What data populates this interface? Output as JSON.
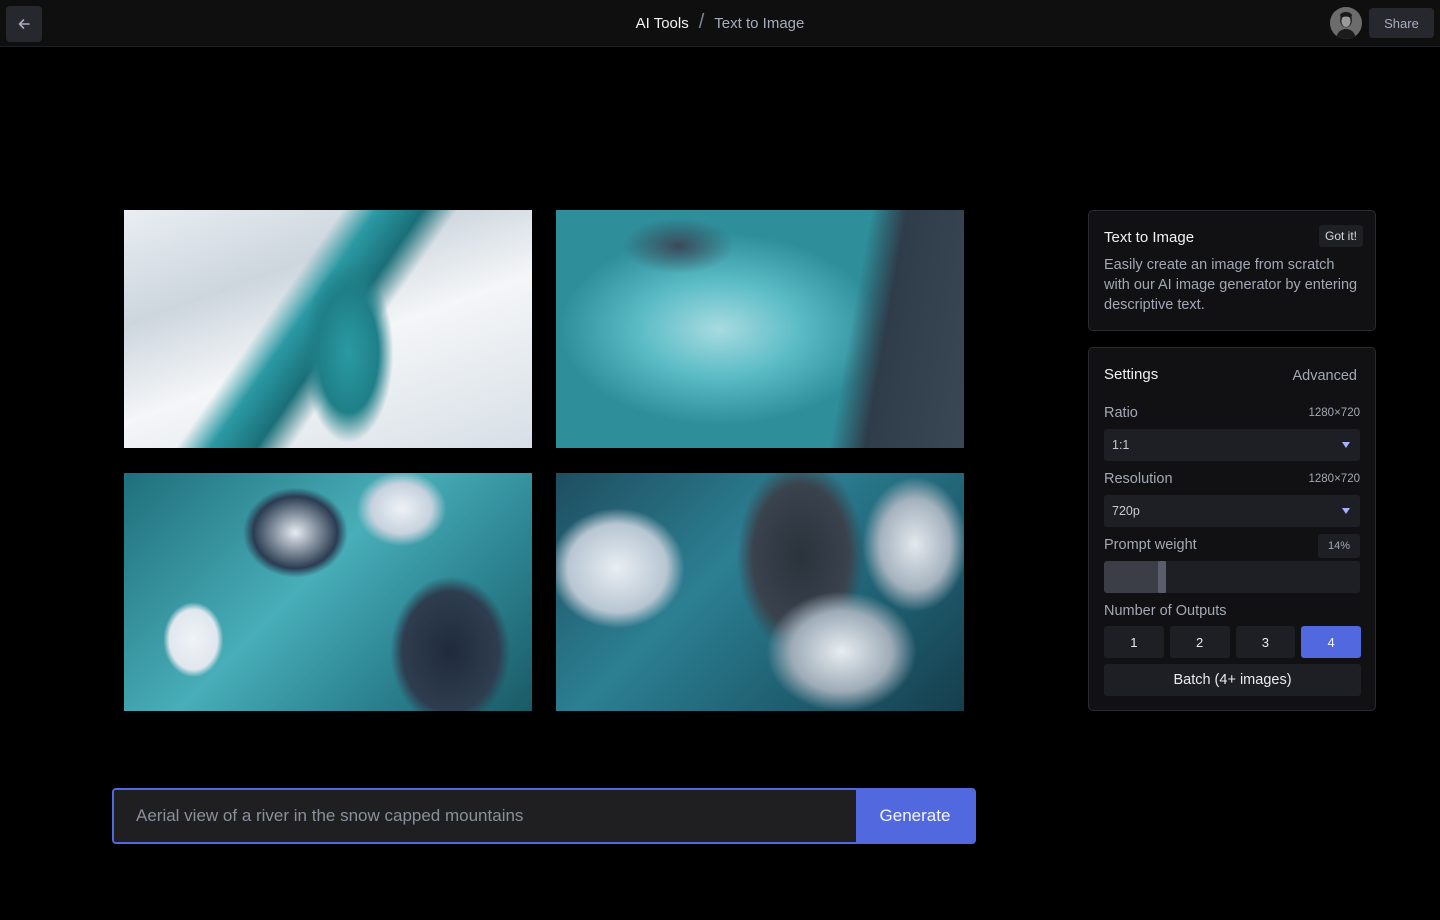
{
  "header": {
    "back_icon": "arrow-left-icon",
    "breadcrumb": {
      "root": "AI Tools",
      "separator": "/",
      "current": "Text to Image"
    },
    "avatar_icon": "user-avatar",
    "share_label": "Share"
  },
  "gallery": {
    "images": [
      {
        "alt": "Aerial view of turquoise river winding through snowy mountains"
      },
      {
        "alt": "Aerial view of turbulent turquoise water beside dark rocks"
      },
      {
        "alt": "Aerial view of glacial river among snow-covered rock islands"
      },
      {
        "alt": "Aerial view of teal river between snowy rocky ridges"
      }
    ]
  },
  "prompt": {
    "value": "",
    "placeholder": "Aerial view of a river in the snow capped mountains",
    "generate_label": "Generate"
  },
  "info_panel": {
    "title": "Text to Image",
    "dismiss_label": "Got it!",
    "description": "Easily create an image from scratch with our AI image generator by entering descriptive text."
  },
  "settings": {
    "title": "Settings",
    "advanced_label": "Advanced",
    "ratio": {
      "label": "Ratio",
      "meta": "1280×720",
      "value": "1:1"
    },
    "resolution": {
      "label": "Resolution",
      "meta": "1280×720",
      "value": "720p"
    },
    "prompt_weight": {
      "label": "Prompt weight",
      "value_text": "14%",
      "value": 0.14
    },
    "outputs": {
      "label": "Number of Outputs",
      "options": [
        "1",
        "2",
        "3",
        "4"
      ],
      "selected": "4",
      "batch_label": "Batch (4+ images)"
    }
  },
  "colors": {
    "accent": "#5168de",
    "background": "#000000",
    "panel": "#111113",
    "control": "#1e1f24"
  }
}
